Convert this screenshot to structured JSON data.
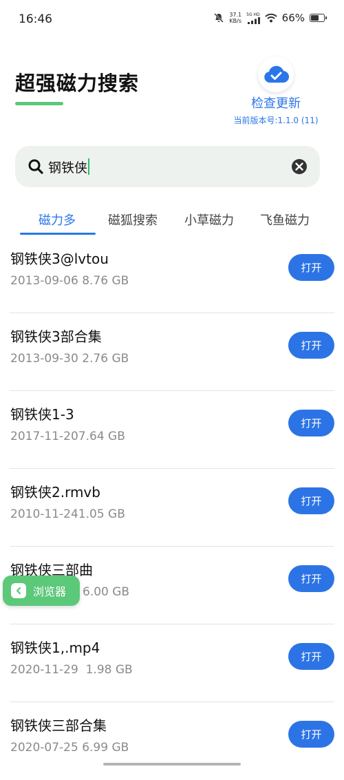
{
  "status_bar": {
    "time": "16:46",
    "net_speed_value": "37.1",
    "net_speed_unit": "KB/s",
    "signal_label": "5G HD",
    "battery_text": "66%",
    "battery_level": 0.66
  },
  "header": {
    "title": "超强磁力搜索",
    "update_label": "检查更新",
    "version": "当前版本号:1.1.0 (11)"
  },
  "search": {
    "value": "钢铁侠"
  },
  "tabs": [
    {
      "label": "磁力多"
    },
    {
      "label": "磁狐搜索"
    },
    {
      "label": "小草磁力"
    },
    {
      "label": "飞鱼磁力"
    }
  ],
  "results": [
    {
      "title": "钢铁侠3@lvtou",
      "meta": "2013-09-06 8.76 GB",
      "action": "打开"
    },
    {
      "title": "钢铁侠3部合集",
      "meta": "2013-09-30 2.76 GB",
      "action": "打开"
    },
    {
      "title": "钢铁侠1-3",
      "meta": "2017-11-207.64 GB",
      "action": "打开"
    },
    {
      "title": "钢铁侠2.rmvb",
      "meta": "2010-11-241.05 GB",
      "action": "打开"
    },
    {
      "title": "钢铁侠三部曲",
      "meta": "6.00 GB",
      "action": "打开"
    },
    {
      "title": "钢铁侠1,.mp4",
      "meta": "2020-11-29  1.98 GB",
      "action": "打开"
    },
    {
      "title": "钢铁侠三部合集",
      "meta": "2020-07-25 6.99 GB",
      "action": "打开"
    }
  ],
  "floating_button": {
    "label": "浏览器"
  },
  "colors": {
    "accent": "#2a76e8",
    "button": "#2c74e6",
    "green": "#5cc87a"
  }
}
